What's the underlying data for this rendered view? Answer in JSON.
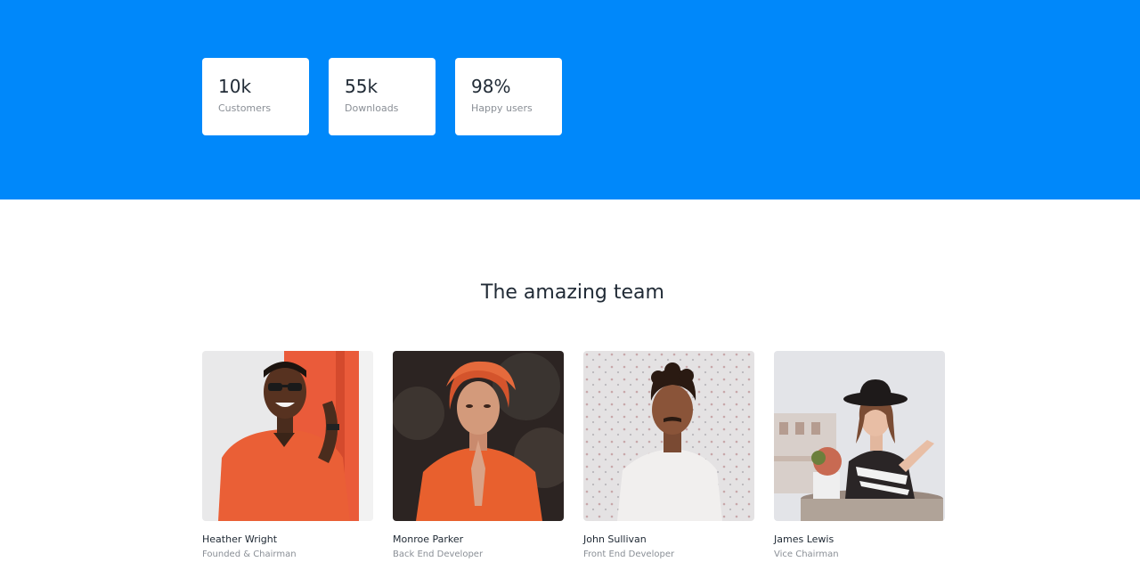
{
  "stats": [
    {
      "value": "10k",
      "label": "Customers"
    },
    {
      "value": "55k",
      "label": "Downloads"
    },
    {
      "value": "98%",
      "label": "Happy users"
    }
  ],
  "team": {
    "title": "The amazing team",
    "members": [
      {
        "name": "Heather Wright",
        "role": "Founded & Chairman"
      },
      {
        "name": "Monroe Parker",
        "role": "Back End Developer"
      },
      {
        "name": "John Sullivan",
        "role": "Front End Developer"
      },
      {
        "name": "James Lewis",
        "role": "Vice Chairman"
      }
    ]
  },
  "colors": {
    "hero_background": "#0088fa",
    "card_background": "#ffffff",
    "heading_text": "#212b36",
    "muted_text": "#8a8f96"
  }
}
